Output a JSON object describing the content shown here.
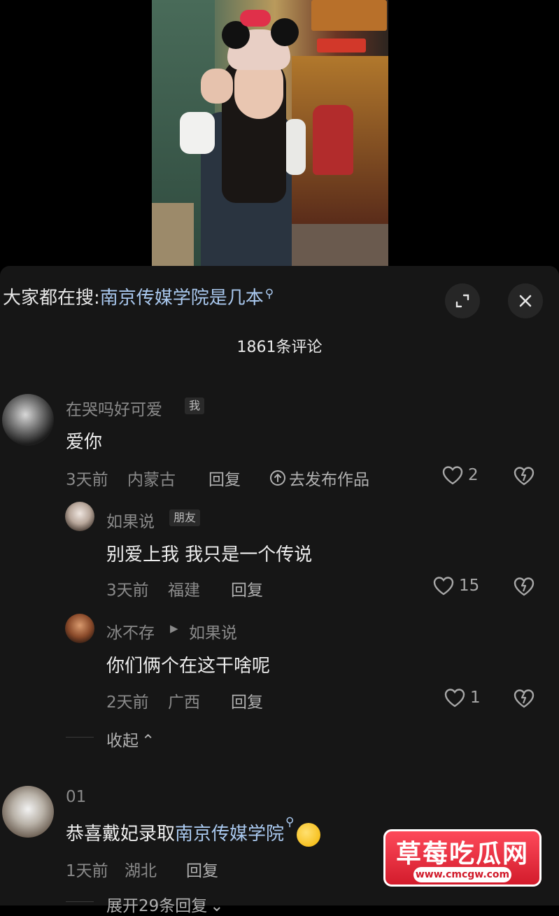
{
  "search_bar": {
    "prefix": "大家都在搜:",
    "query": "南京传媒学院是几本",
    "search_glyph": "⚲"
  },
  "controls": {
    "expand_icon": "expand-icon",
    "close_icon": "close-icon"
  },
  "comment_count": "1861条评论",
  "comments": [
    {
      "username": "在哭吗好可爱",
      "tag": "我",
      "text": "爱你",
      "time": "3天前",
      "location": "内蒙古",
      "reply": "回复",
      "publish": "去发布作品",
      "likes": "2",
      "replies": [
        {
          "username": "如果说",
          "tag": "朋友",
          "text": "别爱上我 我只是一个传说",
          "time": "3天前",
          "location": "福建",
          "reply": "回复",
          "likes": "15"
        },
        {
          "username": "冰不存",
          "reply_to_arrow": "▶",
          "reply_to": "如果说",
          "text": "你们俩个在这干啥呢",
          "time": "2天前",
          "location": "广西",
          "reply": "回复",
          "likes": "1"
        }
      ],
      "collapse_label": "收起",
      "collapse_glyph": "⌃"
    },
    {
      "username": "01",
      "text_before": "恭喜戴妃录取",
      "text_link": "南京传媒学院",
      "link_glyph": "⚲",
      "time": "1天前",
      "location": "湖北",
      "reply": "回复",
      "expand_label": "展开29条回复",
      "expand_glyph": "⌄"
    }
  ],
  "watermark": {
    "title": "草莓吃瓜网",
    "url": "www.cmcgw.com"
  },
  "colors": {
    "sheet_bg": "#161616",
    "link": "#a9c8ee",
    "muted": "#8a8a8a",
    "watermark_red": "#e0253a"
  }
}
